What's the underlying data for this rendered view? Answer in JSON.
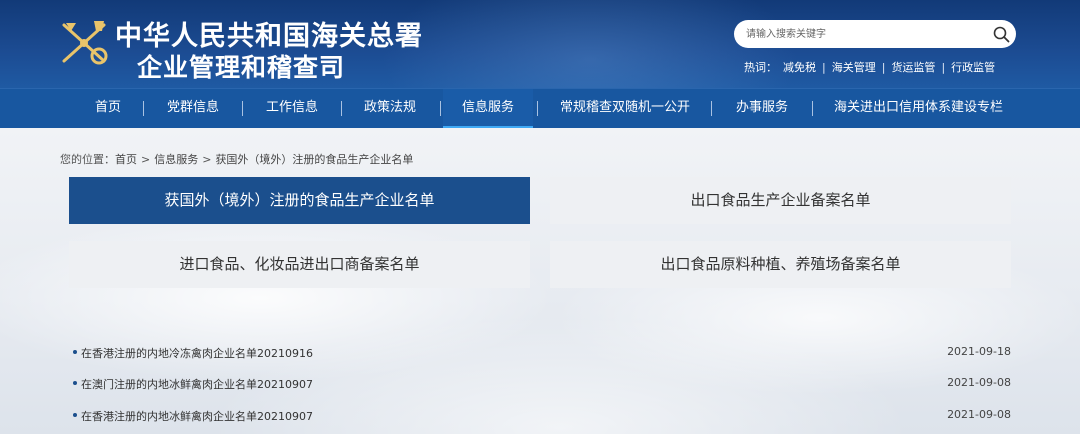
{
  "header": {
    "title_line1": "中华人民共和国海关总署",
    "title_line2": "企业管理和稽查司",
    "emblem_icon": "customs-emblem-icon",
    "search": {
      "placeholder": "请输入搜索关键字",
      "icon": "search-icon"
    },
    "hot": {
      "label": "热词：",
      "links": [
        "减免税",
        "海关管理",
        "货运监管",
        "行政监管"
      ]
    }
  },
  "nav": {
    "items": [
      "首页",
      "党群信息",
      "工作信息",
      "政策法规",
      "信息服务",
      "常规稽查双随机一公开",
      "办事服务",
      "海关进出口信用体系建设专栏"
    ],
    "active_index": 4,
    "separator": "|"
  },
  "breadcrumb": {
    "prefix": "您的位置：",
    "items": [
      "首页",
      "信息服务",
      "获国外（境外）注册的食品生产企业名单"
    ],
    "separator": ">"
  },
  "tabs": [
    {
      "label": "获国外（境外）注册的食品生产企业名单",
      "active": true
    },
    {
      "label": "出口食品生产企业备案名单",
      "active": false
    },
    {
      "label": "进口食品、化妆品进出口商备案名单",
      "active": false
    },
    {
      "label": "出口食品原料种植、养殖场备案名单",
      "active": false
    }
  ],
  "list": [
    {
      "title": "在香港注册的内地冷冻禽肉企业名单20210916",
      "date": "2021-09-18"
    },
    {
      "title": "在澳门注册的内地冰鲜禽肉企业名单20210907",
      "date": "2021-09-08"
    },
    {
      "title": "在香港注册的内地冰鲜禽肉企业名单20210907",
      "date": "2021-09-08"
    }
  ],
  "colors": {
    "header_bg": "#1c4c93",
    "nav_bg": "#1857a0",
    "nav_active_underline": "#3fa9f5",
    "tab_active_bg": "#1b4f8d",
    "tab_bg": "#eef0f3"
  }
}
